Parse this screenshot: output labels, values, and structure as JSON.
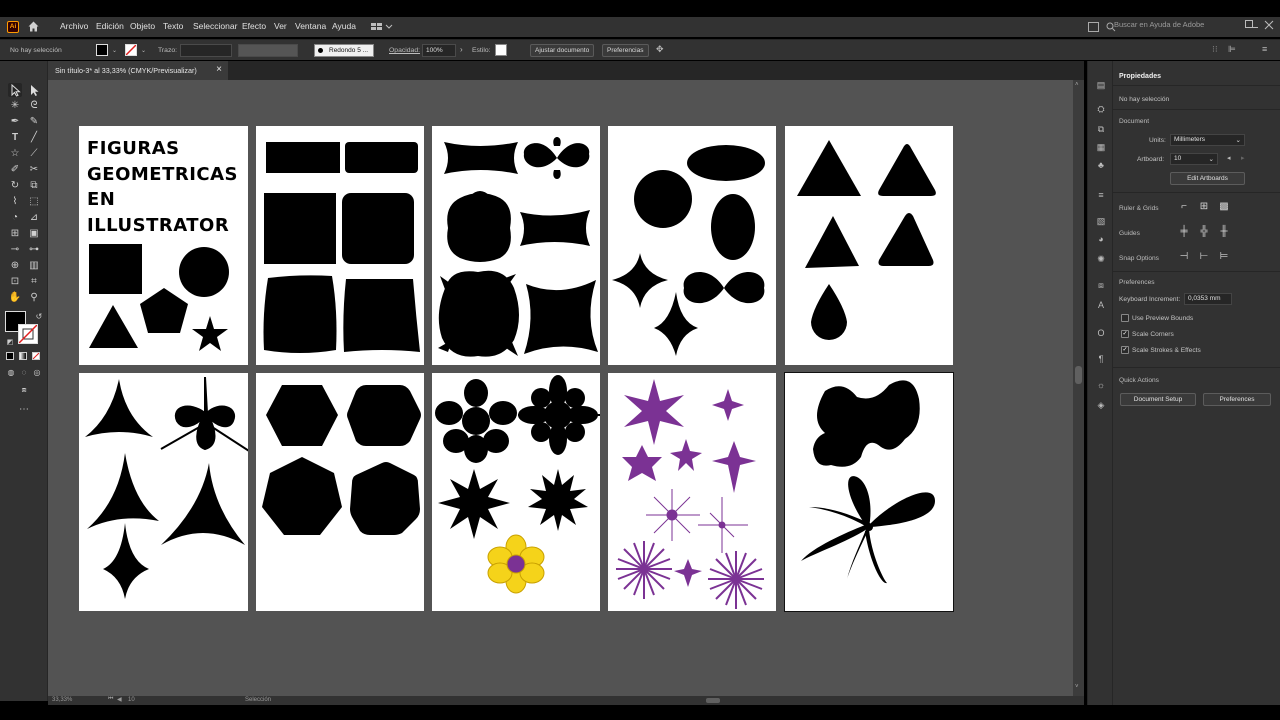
{
  "menu": {
    "logo": "Ai",
    "items": [
      "Archivo",
      "Edición",
      "Objeto",
      "Texto",
      "Seleccionar",
      "Efecto",
      "Ver",
      "Ventana",
      "Ayuda"
    ],
    "search_placeholder": "Buscar en Ayuda de Adobe"
  },
  "control": {
    "selection": "No hay selección",
    "stroke_label": "Trazo:",
    "brush": "Redondo 5 ...",
    "opacity_label": "Opacidad:",
    "opacity_value": "100%",
    "style_label": "Estilo:",
    "adjust_doc": "Ajustar documento",
    "preferences": "Preferencias"
  },
  "document": {
    "tab_title": "Sin título-3* al 33,33% (CMYK/Previsualizar)",
    "close": "×"
  },
  "artboard_title": [
    "FIGURAS",
    "GEOMETRICAS",
    "EN",
    "ILLUSTRATOR"
  ],
  "colors": {
    "purple": "#7b3294",
    "yellow": "#f5d31a",
    "shape": "#000000"
  },
  "status": {
    "zoom": "33,33%",
    "artboard": "10",
    "tool": "Selección"
  },
  "properties": {
    "tab": "Propiedades",
    "no_selection": "No hay selección",
    "document_section": "Document",
    "units_label": "Units:",
    "units_value": "Millimeters",
    "artboard_label": "Artboard:",
    "artboard_value": "10",
    "edit_artboards": "Edit Artboards",
    "ruler_grids": "Ruler & Grids",
    "guides": "Guides",
    "snap_options": "Snap Options",
    "preferences_section": "Preferences",
    "keyboard_increment_label": "Keyboard Increment:",
    "keyboard_increment_value": "0,0353 mm",
    "use_preview_bounds": "Use Preview Bounds",
    "scale_corners": "Scale Corners",
    "scale_strokes": "Scale Strokes & Effects",
    "quick_actions": "Quick Actions",
    "document_setup": "Document Setup",
    "preferences_btn": "Preferences"
  }
}
